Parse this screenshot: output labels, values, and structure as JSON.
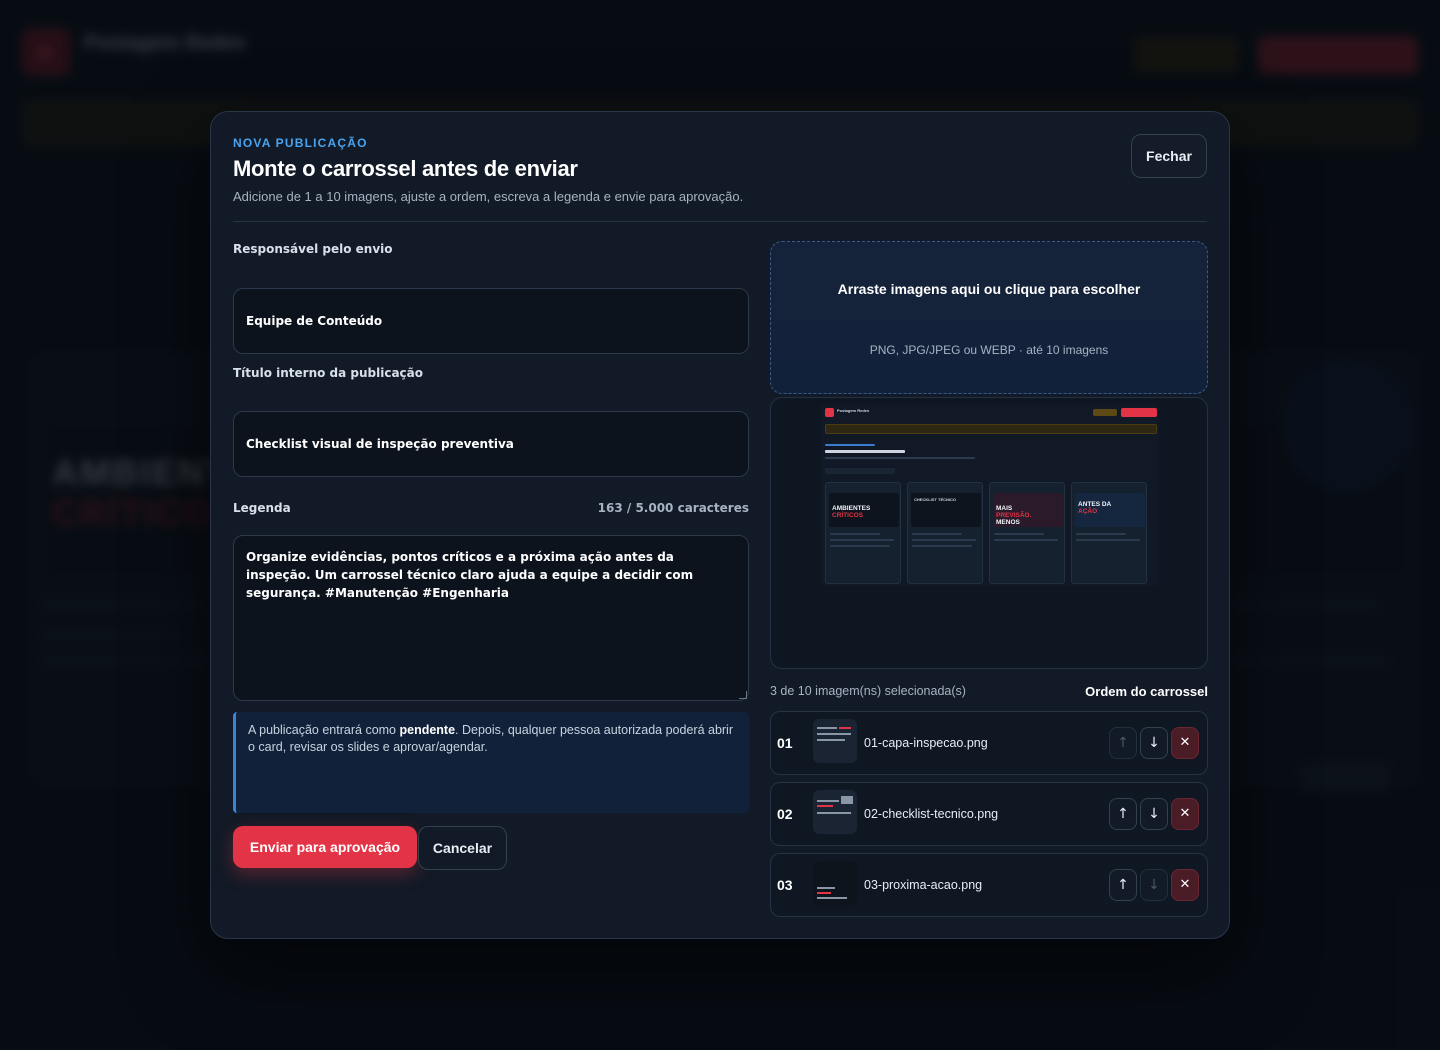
{
  "modal": {
    "kicker": "NOVA PUBLICAÇÃO",
    "title": "Monte o carrossel antes de enviar",
    "description": "Adicione de 1 a 10 imagens, ajuste a ordem, escreva a legenda e envie para aprovação.",
    "close_label": "Fechar"
  },
  "form": {
    "sender_label": "Responsável pelo envio",
    "sender_value": "Equipe de Conteúdo",
    "title_label": "Título interno da publicação",
    "title_value": "Checklist visual de inspeção preventiva",
    "caption_label": "Legenda",
    "caption_count": "163 / 5.000 caracteres",
    "caption_value": "Organize evidências, pontos críticos e a próxima ação antes da inspeção. Um carrossel técnico claro ajuda a equipe a decidir com segurança. #Manutenção #Engenharia",
    "info_before": "A publicação entrará como ",
    "info_bold": "pendente",
    "info_after": ". Depois, qualquer pessoa autorizada poderá abrir o card, revisar os slides e aprovar/agendar.",
    "submit_label": "Enviar para aprovação",
    "cancel_label": "Cancelar"
  },
  "upload": {
    "dropzone_title": "Arraste imagens aqui ou clique para escolher",
    "dropzone_hint": "PNG, JPG/JPEG ou WEBP · até 10 imagens",
    "selected_count": "3 de 10 imagem(ns) selecionada(s)",
    "order_title": "Ordem do carrossel",
    "items": [
      {
        "index": "01",
        "filename": "01-capa-inspecao.png"
      },
      {
        "index": "02",
        "filename": "02-checklist-tecnico.png"
      },
      {
        "index": "03",
        "filename": "03-proxima-acao.png"
      }
    ],
    "icons": {
      "move_up": "↑",
      "move_down": "↓",
      "remove": "✕"
    }
  },
  "preview": {
    "app_title": "Postagem Redes",
    "card_1_big": "AMBIENTES",
    "card_1_red": "CRÍTICOS",
    "card_2_head": "CHECKLIST TÉCNICO",
    "card_3_big": "MAIS",
    "card_3_red": "PREVISÃO.",
    "card_3_tail": "MENOS",
    "card_4_big": "ANTES DA",
    "card_4_red": "AÇÃO"
  },
  "colors": {
    "accent": "#e23446",
    "kicker": "#4aa3f0",
    "info_border": "#3d82d6"
  }
}
